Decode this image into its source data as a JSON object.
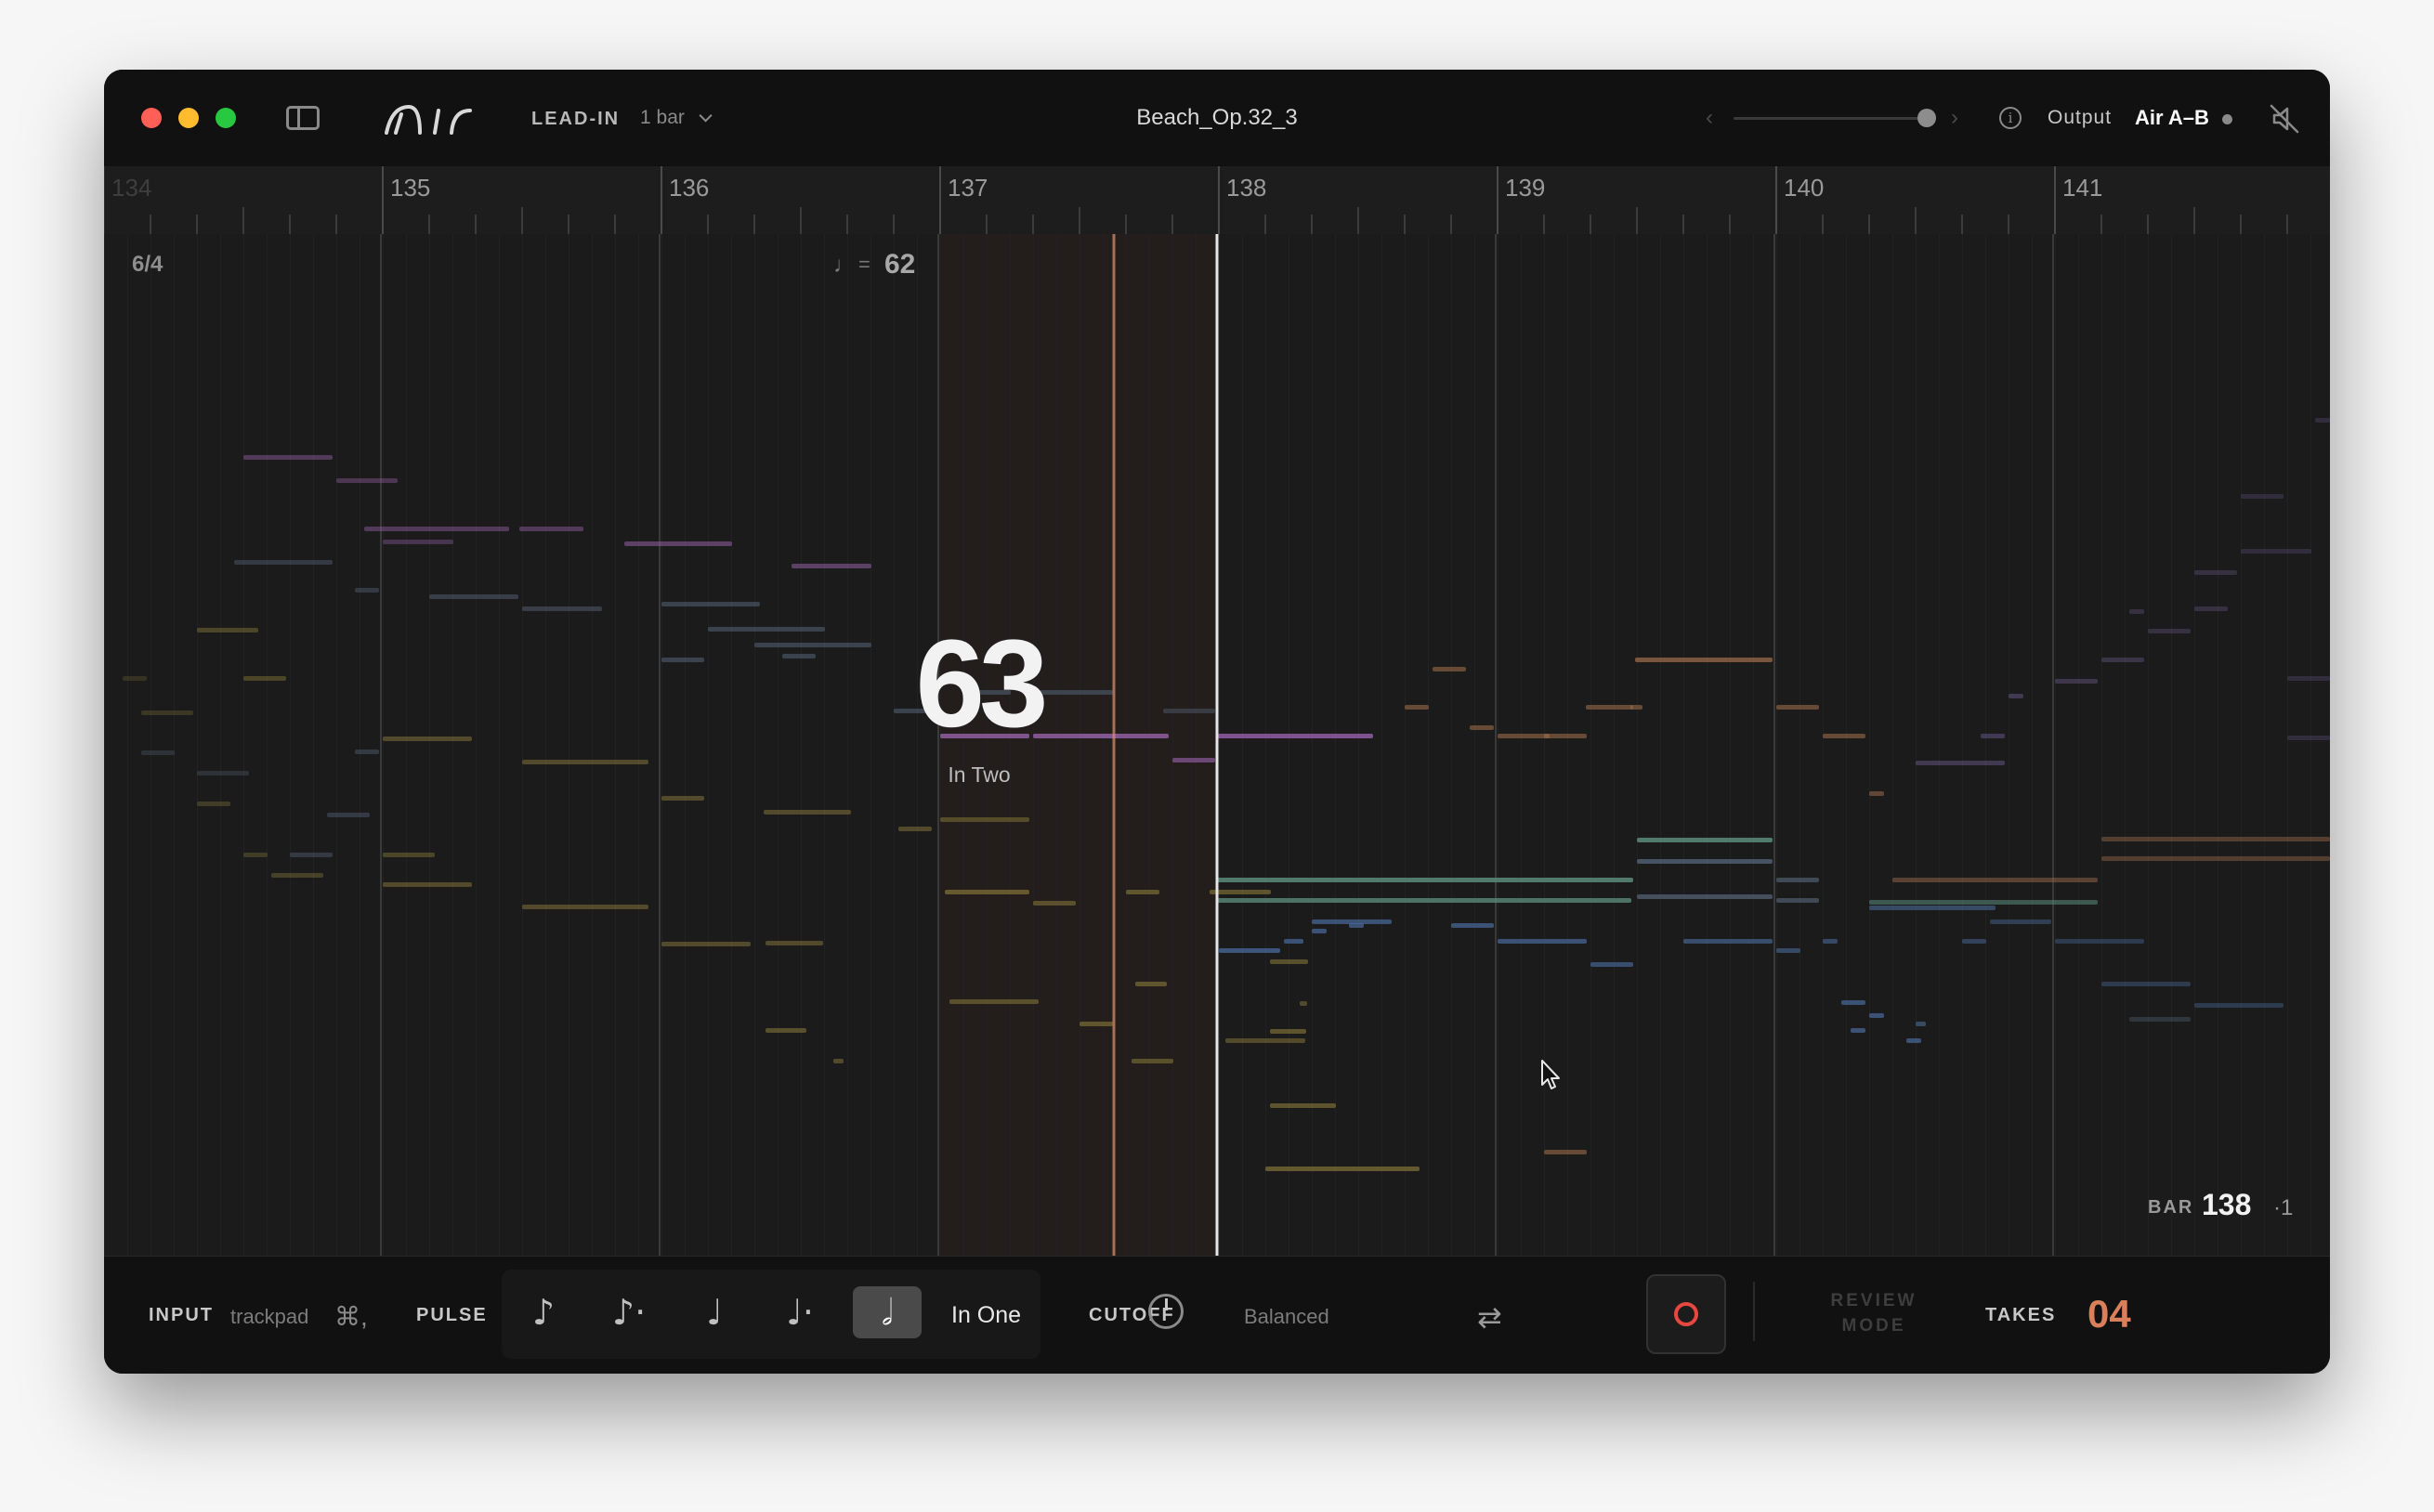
{
  "titlebar": {
    "lead_in_label": "LEAD-IN",
    "lead_in_value": "1 bar",
    "file_title": "Beach_Op.32_3",
    "output_label": "Output",
    "output_value": "Air A–B",
    "icons": [
      "close",
      "minimize",
      "zoom",
      "sidebar-toggle",
      "air-logo",
      "chevron-down",
      "chevron-left",
      "chevron-right",
      "info",
      "speaker-mute"
    ]
  },
  "ruler": {
    "bars": [
      "134",
      "135",
      "136",
      "137",
      "138",
      "139",
      "140",
      "141"
    ]
  },
  "score": {
    "time_signature": "6/4",
    "tempo_note_symbol": "♩",
    "tempo_equals": "=",
    "tempo_marking": "62",
    "current_tempo": "63",
    "tempo_mode": "In Two",
    "bar_label": "BAR",
    "bar_value": "138",
    "beat_value": "·1"
  },
  "bottombar": {
    "input_label": "INPUT",
    "input_value": "trackpad",
    "input_shortcut": "⌘,",
    "pulse_label": "PULSE",
    "pulse_options": [
      "♪",
      "♪·",
      "♩",
      "♩·",
      "𝅗𝅥"
    ],
    "pulse_selected_index": 4,
    "pulse_in_one": "In One",
    "cutoff_label": "CUTOFF",
    "cutoff_value": "Balanced",
    "review_line1": "REVIEW",
    "review_line2": "MODE",
    "takes_label": "TAKES",
    "takes_value": "04"
  },
  "colors": {
    "playhead": "#d98b6a",
    "record": "#e5483e",
    "takes": "#d9805a",
    "note_palette": [
      "#8a5a9a",
      "#5a6a80",
      "#8a7a3a",
      "#9a6a4a",
      "#5a8a7a",
      "#4a6a9a",
      "#6a5a8a"
    ]
  }
}
